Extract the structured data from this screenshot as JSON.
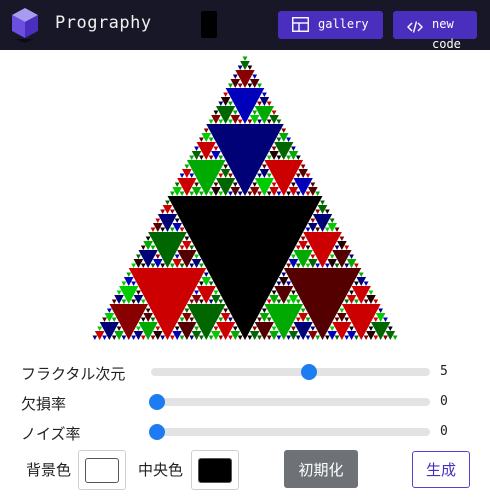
{
  "header": {
    "title": "Prography",
    "logo_icon": "cube-logo-icon",
    "gallery_label": "gallery",
    "gallery_icon": "layout-icon",
    "newcode_label": "new code",
    "newcode_icon": "code-icon",
    "bg_color": "#171727",
    "button_color": "#4a2fbf"
  },
  "fractal": {
    "depth": 5,
    "colors": [
      "#000000",
      "#cc0000",
      "#880000",
      "#006600",
      "#00aa00",
      "#000077",
      "#0000bb",
      "#220000",
      "#550000",
      "#00cc00"
    ]
  },
  "controls": {
    "dimension": {
      "label": "フラクタル次元",
      "value": "5",
      "fraction": 0.57
    },
    "defect": {
      "label": "欠損率",
      "value": "0",
      "fraction": 0
    },
    "noise": {
      "label": "ノイズ率",
      "value": "0",
      "fraction": 0
    },
    "thumb_color": "#1e7cf2"
  },
  "colors": {
    "background_label": "背景色",
    "background_value": "#ffffff",
    "center_label": "中央色",
    "center_value": "#000000"
  },
  "buttons": {
    "reset_label": "初期化",
    "generate_label": "生成"
  }
}
